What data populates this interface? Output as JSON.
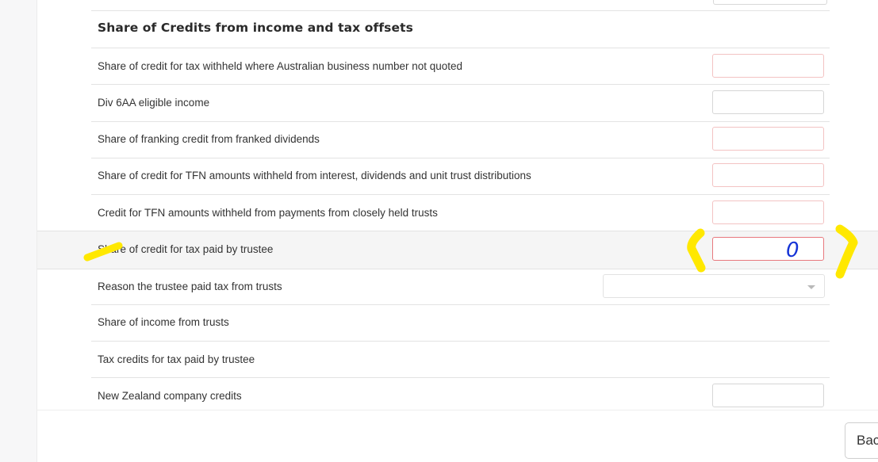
{
  "section": {
    "title": "Share of Credits from income and tax offsets"
  },
  "rows": [
    {
      "label": "Share of credit for tax withheld where Australian business number not quoted",
      "value": ""
    },
    {
      "label": "Div 6AA eligible income",
      "value": ""
    },
    {
      "label": "Share of franking credit from franked dividends",
      "value": ""
    },
    {
      "label": "Share of credit for TFN amounts withheld from interest, dividends and unit trust distributions",
      "value": ""
    },
    {
      "label": "Credit for TFN amounts withheld from payments from closely held trusts",
      "value": ""
    },
    {
      "label": "Share of credit for tax paid by trustee",
      "value": ""
    },
    {
      "label": "Reason the trustee paid tax from trusts",
      "value": ""
    },
    {
      "label": "Share of income from trusts"
    },
    {
      "label": "Tax credits for tax paid by trustee"
    },
    {
      "label": "New Zealand company credits",
      "value": ""
    }
  ],
  "footer": {
    "back_label": "Bac"
  },
  "annotation": {
    "handwritten_value": "0",
    "marker_color": "#ffe800",
    "pen_color": "#1533d6"
  },
  "colors": {
    "error_border": "#f3c3c3",
    "focused_error_border": "#e8797e",
    "highlight_row": "#f5f5f5"
  }
}
